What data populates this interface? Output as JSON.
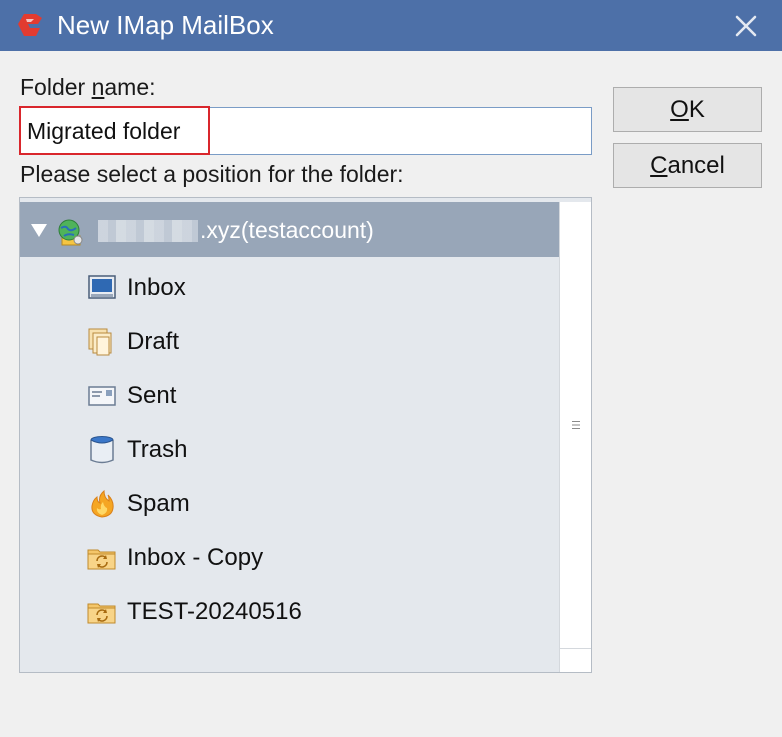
{
  "window": {
    "title": "New IMap MailBox"
  },
  "form": {
    "folder_label_prefix": "Folder ",
    "folder_label_accel": "n",
    "folder_label_suffix": "ame:",
    "folder_value": "Migrated folder",
    "position_label": "Please select a position for the folder:"
  },
  "buttons": {
    "ok_accel": "O",
    "ok_rest": "K",
    "cancel_accel": "C",
    "cancel_rest": "ancel"
  },
  "tree": {
    "account_label": ".xyz(testaccount)",
    "items": [
      {
        "label": "Inbox",
        "icon": "inbox-icon"
      },
      {
        "label": "Draft",
        "icon": "draft-icon"
      },
      {
        "label": "Sent",
        "icon": "sent-icon"
      },
      {
        "label": "Trash",
        "icon": "trash-icon"
      },
      {
        "label": "Spam",
        "icon": "spam-icon"
      },
      {
        "label": "Inbox - Copy",
        "icon": "sync-folder-icon"
      },
      {
        "label": "TEST-20240516",
        "icon": "sync-folder-icon"
      }
    ]
  },
  "colors": {
    "titlebar": "#4d70a8",
    "highlight": "#d9262c",
    "tree_header": "#98a6b8",
    "tree_bg": "#e4e8ed"
  }
}
